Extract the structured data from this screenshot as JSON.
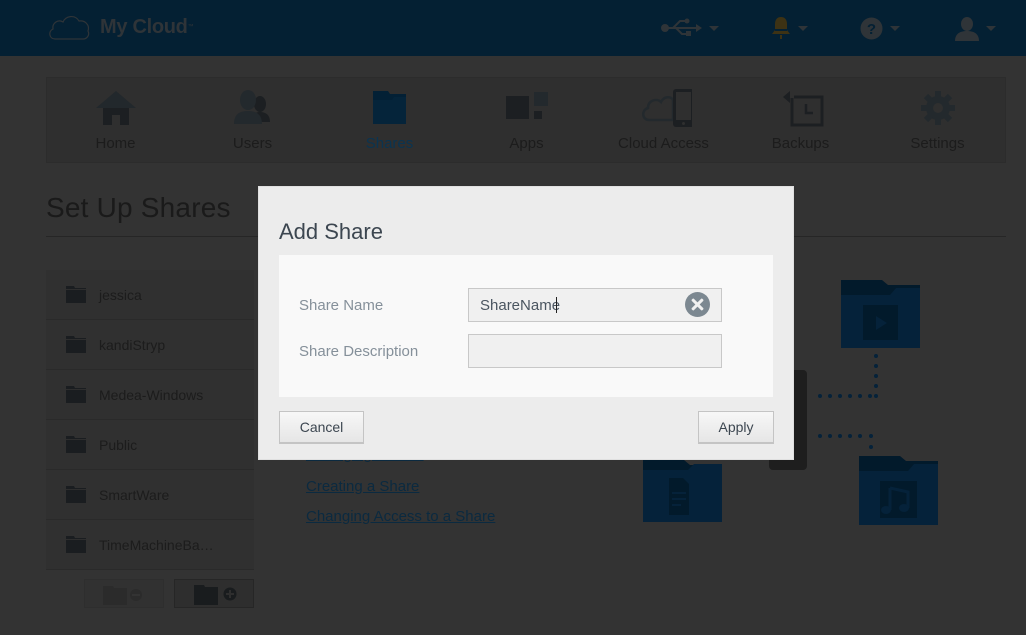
{
  "app": {
    "name": "My Cloud",
    "trademark": "™"
  },
  "topbar": {
    "icons": [
      {
        "name": "usb-icon",
        "has_dropdown": true
      },
      {
        "name": "bell-icon",
        "has_dropdown": true
      },
      {
        "name": "help-icon",
        "has_dropdown": true
      },
      {
        "name": "user-icon",
        "has_dropdown": true
      }
    ]
  },
  "nav": {
    "items": [
      {
        "label": "Home",
        "icon": "home-icon",
        "active": false
      },
      {
        "label": "Users",
        "icon": "users-icon",
        "active": false
      },
      {
        "label": "Shares",
        "icon": "folder-icon",
        "active": true
      },
      {
        "label": "Apps",
        "icon": "apps-icon",
        "active": false
      },
      {
        "label": "Cloud Access",
        "icon": "cloud-phone-icon",
        "active": false
      },
      {
        "label": "Backups",
        "icon": "backup-icon",
        "active": false
      },
      {
        "label": "Settings",
        "icon": "gear-icon",
        "active": false
      }
    ]
  },
  "page": {
    "title": "Set Up Shares"
  },
  "shares": {
    "items": [
      {
        "name": "jessica"
      },
      {
        "name": "kandiStryp"
      },
      {
        "name": "Medea-Windows"
      },
      {
        "name": "Public"
      },
      {
        "name": "SmartWare"
      },
      {
        "name": "TimeMachineBa…"
      }
    ],
    "remove_button": "remove-share",
    "add_button": "add-share"
  },
  "help": {
    "links": [
      {
        "label": "Managing Shares"
      },
      {
        "label": "Creating a Share"
      },
      {
        "label": "Changing Access to a Share"
      }
    ]
  },
  "colors": {
    "brand_dark": "#042033",
    "accent_blue": "#0b3450",
    "overlay_bg": "#333333"
  },
  "dialog": {
    "title": "Add Share",
    "fields": [
      {
        "label": "Share Name",
        "value": "ShareName",
        "placeholder": ""
      },
      {
        "label": "Share Description",
        "value": "",
        "placeholder": ""
      }
    ],
    "cancel_label": "Cancel",
    "apply_label": "Apply"
  }
}
